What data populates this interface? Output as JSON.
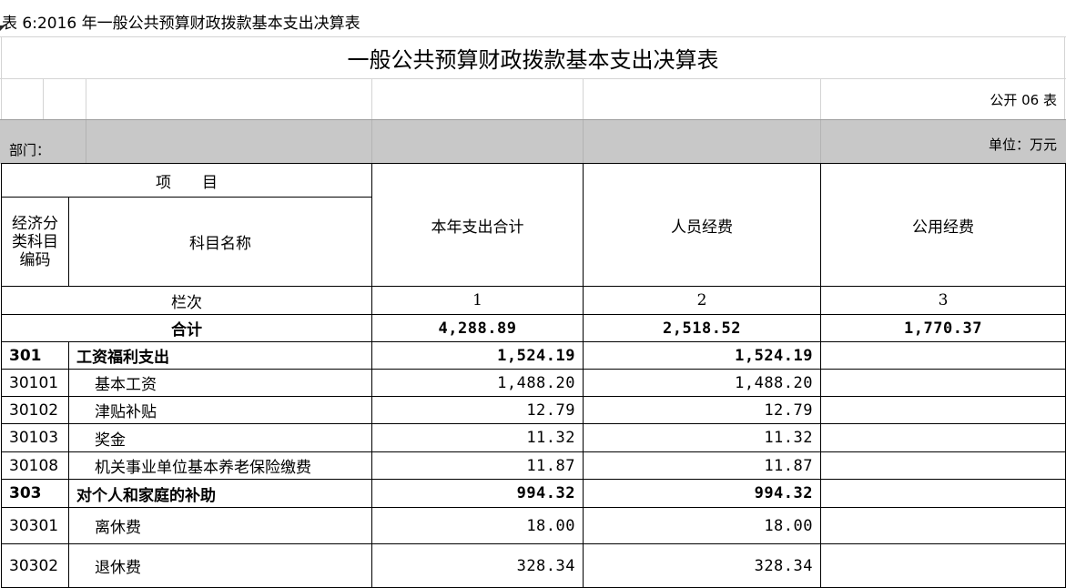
{
  "sheet_title": "表 6:2016 年一般公共预算财政拨款基本支出决算表",
  "report": {
    "title": "一般公共预算财政拨款基本支出决算表",
    "form_no": "公开 06 表",
    "dept_label": "部门：",
    "unit_label": "单位：万元"
  },
  "header": {
    "project": "项　　目",
    "econ_code": "经济分类科目编码",
    "subject_name": "科目名称",
    "col_total": "本年支出合计",
    "col_personnel": "人员经费",
    "col_public": "公用经费",
    "column_no_label": "栏次",
    "no1": "1",
    "no2": "2",
    "no3": "3"
  },
  "total": {
    "label": "合计",
    "total": "4,288.89",
    "personnel": "2,518.52",
    "public": "1,770.37"
  },
  "rows": [
    {
      "code": "301",
      "name": "工资福利支出",
      "total": "1,524.19",
      "personnel": "1,524.19",
      "public": "",
      "bold": true
    },
    {
      "code": "30101",
      "name": "基本工资",
      "total": "1,488.20",
      "personnel": "1,488.20",
      "public": "",
      "bold": false
    },
    {
      "code": "30102",
      "name": "津贴补贴",
      "total": "12.79",
      "personnel": "12.79",
      "public": "",
      "bold": false
    },
    {
      "code": "30103",
      "name": "奖金",
      "total": "11.32",
      "personnel": "11.32",
      "public": "",
      "bold": false
    },
    {
      "code": "30108",
      "name": "机关事业单位基本养老保险缴费",
      "total": "11.87",
      "personnel": "11.87",
      "public": "",
      "bold": false
    },
    {
      "code": "303",
      "name": "对个人和家庭的补助",
      "total": "994.32",
      "personnel": "994.32",
      "public": "",
      "bold": true
    },
    {
      "code": "30301",
      "name": "离休费",
      "total": "18.00",
      "personnel": "18.00",
      "public": "",
      "bold": false
    },
    {
      "code": "30302",
      "name": "退休费",
      "total": "328.34",
      "personnel": "328.34",
      "public": "",
      "bold": false
    }
  ]
}
